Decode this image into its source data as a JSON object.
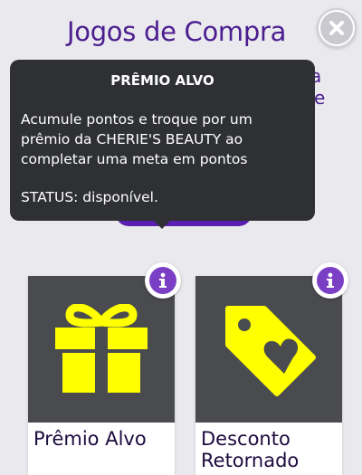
{
  "header": {
    "title": "Jogos de Compra",
    "close_icon": "close-icon"
  },
  "background": {
    "fragment_1": "a",
    "fragment_2": "e"
  },
  "tooltip": {
    "title": "PRÊMIO ALVO",
    "body": "Acumule pontos e troque por um prêmio da CHERIE'S BEAUTY ao completar uma meta em pontos",
    "status": "STATUS: disponível."
  },
  "cards": [
    {
      "label": "Prêmio Alvo",
      "icon": "gift-icon",
      "info_icon": "info-icon"
    },
    {
      "label": "Desconto Retornado",
      "icon": "price-tag-heart-icon",
      "info_icon": "info-icon"
    }
  ],
  "colors": {
    "title": "#4b1d8f",
    "accent": "#7a3fc4",
    "icon_yellow": "#ffff00",
    "card_bg": "#4a4b4e",
    "tooltip_bg": "#2f3033"
  }
}
